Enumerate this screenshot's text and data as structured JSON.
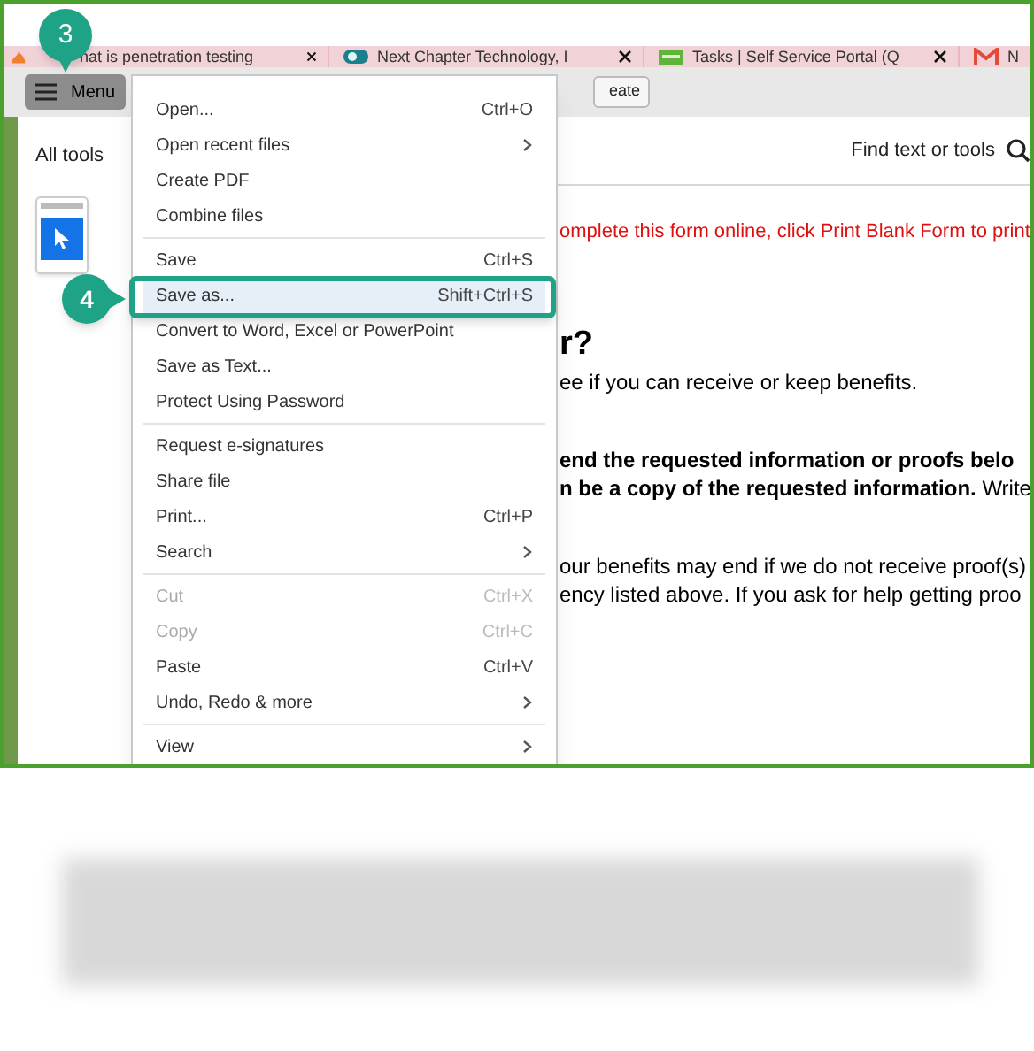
{
  "browser_tabs": [
    {
      "title": "hat is penetration testing",
      "kind": "flame"
    },
    {
      "title": "Next Chapter Technology, I",
      "kind": "s"
    },
    {
      "title": "Tasks | Self Service Portal (Q",
      "kind": "nct"
    },
    {
      "title": "N",
      "kind": "mail"
    }
  ],
  "toolbar": {
    "menu_button": "Menu",
    "partial_button": "eate"
  },
  "sidebar": {
    "title": "All tools"
  },
  "search": {
    "label": "Find text or tools"
  },
  "document": {
    "lines": [
      {
        "kind": "notice",
        "text": "omplete this form online, click Print Blank Form to print"
      },
      {
        "kind": "heading",
        "text": "r?"
      },
      {
        "kind": "body",
        "text": "ee if you can receive or keep benefits."
      },
      {
        "kind": "gap"
      },
      {
        "kind": "bold",
        "text": "end the requested information or proofs belo"
      },
      {
        "kind": "body",
        "text": "**n be a copy of the requested information.** Write"
      },
      {
        "kind": "gap"
      },
      {
        "kind": "body",
        "text": "our benefits may end if we do not receive proof(s)"
      },
      {
        "kind": "body",
        "text": "ency listed above. If you ask for help getting proo"
      }
    ]
  },
  "menu": {
    "groups": [
      [
        {
          "label": "Open...",
          "shortcut": "Ctrl+O",
          "submenu": false,
          "disabled": false,
          "selected": false
        },
        {
          "label": "Open recent files",
          "submenu": true,
          "disabled": false,
          "selected": false
        },
        {
          "label": "Create PDF",
          "submenu": false,
          "disabled": false,
          "selected": false
        },
        {
          "label": "Combine files",
          "submenu": false,
          "disabled": false,
          "selected": false
        }
      ],
      [
        {
          "label": "Save",
          "shortcut": "Ctrl+S",
          "submenu": false,
          "disabled": false,
          "selected": false
        },
        {
          "label": "Save as...",
          "shortcut": "Shift+Ctrl+S",
          "submenu": false,
          "disabled": false,
          "selected": true
        },
        {
          "label": "Convert to Word, Excel or PowerPoint",
          "submenu": false,
          "disabled": false,
          "selected": false
        },
        {
          "label": "Save as Text...",
          "submenu": false,
          "disabled": false,
          "selected": false
        },
        {
          "label": "Protect Using Password",
          "submenu": false,
          "disabled": false,
          "selected": false
        }
      ],
      [
        {
          "label": "Request e-signatures",
          "submenu": false,
          "disabled": false,
          "selected": false
        },
        {
          "label": "Share file",
          "submenu": false,
          "disabled": false,
          "selected": false
        },
        {
          "label": "Print...",
          "shortcut": "Ctrl+P",
          "submenu": false,
          "disabled": false,
          "selected": false
        },
        {
          "label": "Search",
          "submenu": true,
          "disabled": false,
          "selected": false
        }
      ],
      [
        {
          "label": "Cut",
          "shortcut": "Ctrl+X",
          "submenu": false,
          "disabled": true,
          "selected": false
        },
        {
          "label": "Copy",
          "shortcut": "Ctrl+C",
          "submenu": false,
          "disabled": true,
          "selected": false
        },
        {
          "label": "Paste",
          "shortcut": "Ctrl+V",
          "submenu": false,
          "disabled": false,
          "selected": false
        },
        {
          "label": "Undo, Redo & more",
          "submenu": true,
          "disabled": false,
          "selected": false
        }
      ],
      [
        {
          "label": "View",
          "submenu": true,
          "disabled": false,
          "selected": false
        }
      ]
    ]
  },
  "callouts": [
    {
      "number": "3",
      "kind": "down"
    },
    {
      "number": "4",
      "kind": "right"
    }
  ]
}
